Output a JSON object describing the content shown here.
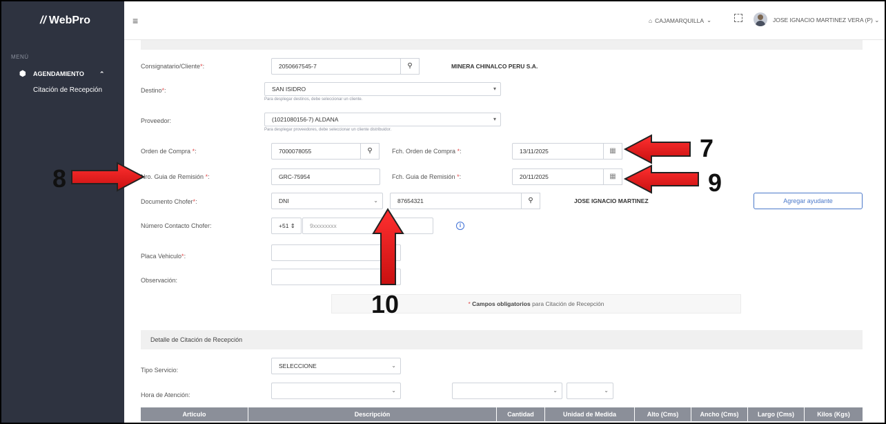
{
  "app": {
    "brand": "WebPro",
    "brand_mark": "//",
    "hamburger": "≡",
    "location": "CAJAMARQUILLA",
    "username": "JOSE IGNACIO MARTINEZ VERA (P)"
  },
  "sidebar": {
    "menu_label": "MENÚ",
    "group_label": "AGENDAMIENTO",
    "sub_item": "Citación de Recepción"
  },
  "form": {
    "consignatario": {
      "label": "Consignatario/Cliente",
      "value": "2050667545-7",
      "result": "MINERA CHINALCO PERU S.A."
    },
    "destino": {
      "label": "Destino",
      "value": "SAN ISIDRO",
      "hint": "Para desplegar destinos, debe seleccionar un cliente."
    },
    "proveedor": {
      "label": "Proveedor:",
      "value": "(1021080156-7) ALDANA",
      "hint": "Para desplegar proveedores, debe seleccionar un cliente distribuidor."
    },
    "orden_compra": {
      "label": "Orden de Compra",
      "value": "7000078055"
    },
    "fch_orden": {
      "label": "Fch. Orden de Compra",
      "value": "13/11/2025"
    },
    "guia": {
      "label": "Nro. Guia de Remisión",
      "value": "GRC-75954"
    },
    "fch_guia": {
      "label": "Fch. Guia de Remisión",
      "value": "20/11/2025"
    },
    "doc_chofer": {
      "label": "Documento Chofer",
      "type_value": "DNI",
      "number_value": "87654321",
      "result": "JOSE IGNACIO MARTINEZ"
    },
    "agregar_ayudante": "Agregar ayudante",
    "contacto": {
      "label": "Número Contacto Chofer:",
      "prefix": "+51",
      "placeholder": "9xxxxxxxx"
    },
    "placa": {
      "label": "Placa Vehiculo"
    },
    "observacion": {
      "label": "Observación:"
    },
    "notice_bold": "Campos obligatorios",
    "notice_rest": " para Citación de Recepción"
  },
  "detalle": {
    "section_title": "Detalle de Citación de Recepción",
    "tipo_servicio": {
      "label": "Tipo Servicio:",
      "value": "SELECCIONE"
    },
    "hora_atencion": {
      "label": "Hora de Atención:"
    },
    "table_headers": [
      "Articulo",
      "Descripción",
      "Cantidad",
      "Unidad de Medida",
      "Alto (Cms)",
      "Ancho (Cms)",
      "Largo (Cms)",
      "Kilos (Kgs)"
    ]
  },
  "annotations": {
    "a7": "7",
    "a8": "8",
    "a9": "9",
    "a10": "10"
  },
  "colors": {
    "sidebar_bg": "#2e3340",
    "arrow_red": "#e41e1e",
    "required": "#e04848",
    "accent_blue": "#4a78c9"
  }
}
